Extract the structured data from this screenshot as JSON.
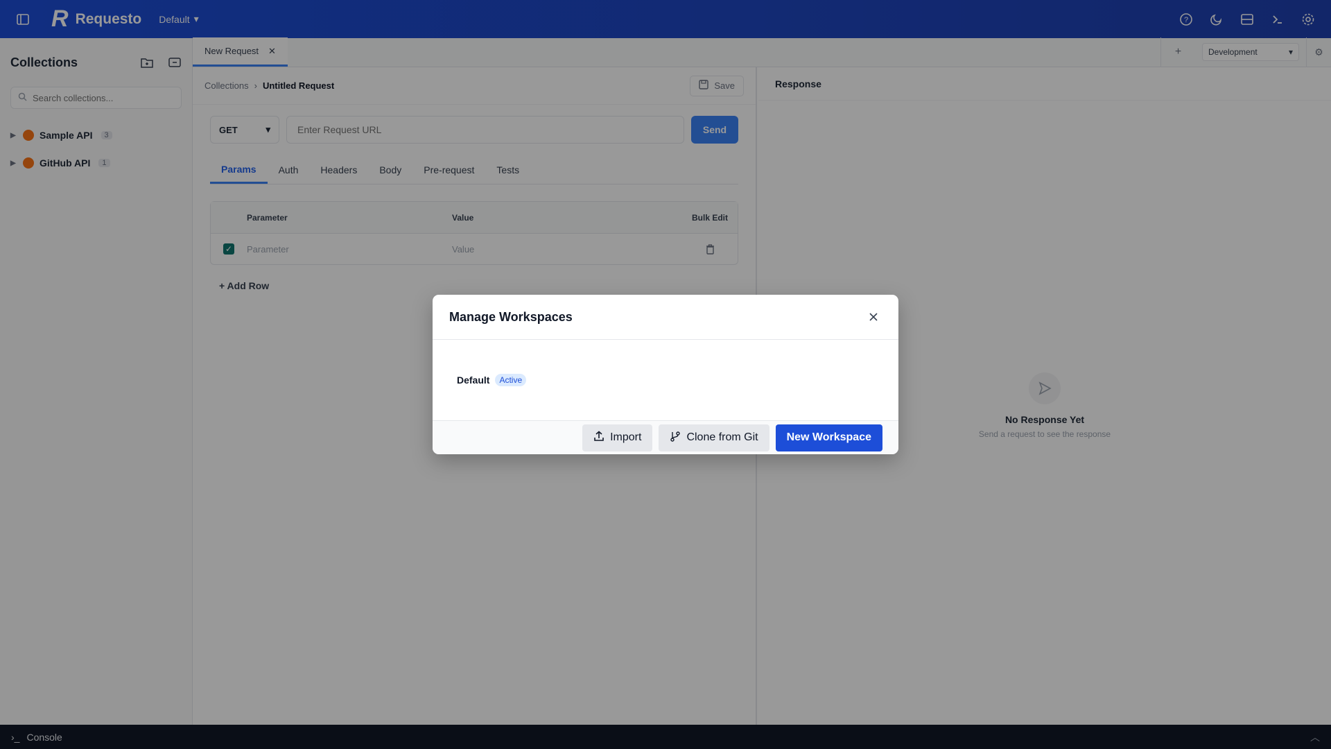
{
  "app": {
    "name": "Requesto",
    "logo": "R",
    "workspace": "Default"
  },
  "topbar": {
    "icons": [
      "help-icon",
      "moon-icon",
      "layout-icon",
      "terminal-icon",
      "settings-icon"
    ]
  },
  "sidebar": {
    "title": "Collections",
    "search_placeholder": "Search collections...",
    "collections": [
      {
        "name": "Sample API",
        "count": "3"
      },
      {
        "name": "GitHub API",
        "count": "1"
      }
    ]
  },
  "tabs": {
    "items": [
      {
        "label": "New Request"
      }
    ],
    "environment": "Development"
  },
  "request": {
    "breadcrumb_root": "Collections",
    "breadcrumb_separator": "›",
    "breadcrumb_current": "Untitled Request",
    "save_label": "Save",
    "method": "GET",
    "url_placeholder": "Enter Request URL",
    "send_label": "Send",
    "tabs": [
      "Params",
      "Auth",
      "Headers",
      "Body",
      "Pre-request",
      "Tests"
    ],
    "active_tab": "Params",
    "params_table": {
      "headers": [
        "Parameter",
        "Value",
        "Bulk Edit"
      ],
      "row": {
        "key_placeholder": "Parameter",
        "value_placeholder": "Value"
      }
    },
    "add_row_label": "+ Add Row"
  },
  "response": {
    "title": "Response",
    "empty_title": "No Response Yet",
    "empty_subtitle": "Send a request to see the response"
  },
  "console": {
    "label": "Console"
  },
  "modal": {
    "title": "Manage Workspaces",
    "workspaces": [
      {
        "name": "Default",
        "badge": "Active"
      }
    ],
    "buttons": {
      "import": "Import",
      "clone": "Clone from Git",
      "new": "New Workspace"
    }
  },
  "colors": {
    "brand": "#1d4ed8",
    "accent": "#3b82f6",
    "active_badge_bg": "#dbeafe"
  }
}
